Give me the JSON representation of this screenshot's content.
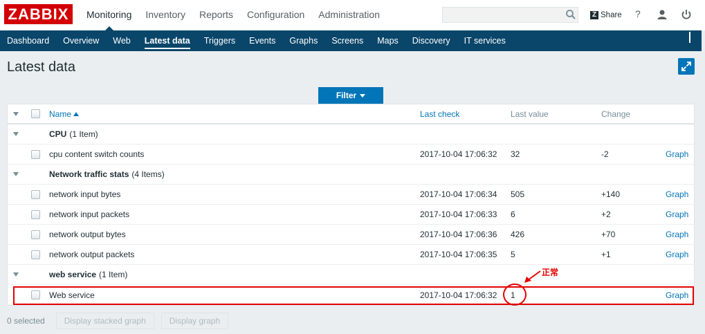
{
  "logo": "ZABBIX",
  "main_menu": [
    "Monitoring",
    "Inventory",
    "Reports",
    "Configuration",
    "Administration"
  ],
  "share_label": "Share",
  "help_label": "?",
  "sub_menu": [
    "Dashboard",
    "Overview",
    "Web",
    "Latest data",
    "Triggers",
    "Events",
    "Graphs",
    "Screens",
    "Maps",
    "Discovery",
    "IT services"
  ],
  "page_title": "Latest data",
  "filter_label": "Filter",
  "table": {
    "headers": {
      "name": "Name",
      "last_check": "Last check",
      "last_value": "Last value",
      "change": "Change"
    },
    "groups": [
      {
        "name": "CPU",
        "count": "(1 Item)"
      },
      {
        "name": "Network traffic stats",
        "count": "(4 Items)"
      },
      {
        "name": "web service",
        "count": "(1 Item)"
      }
    ],
    "rows": [
      {
        "name": "cpu content switch counts",
        "last_check": "2017-10-04 17:06:32",
        "last_value": "32",
        "change": "-2",
        "action": "Graph"
      },
      {
        "name": "network input bytes",
        "last_check": "2017-10-04 17:06:34",
        "last_value": "505",
        "change": "+140",
        "action": "Graph"
      },
      {
        "name": "network input packets",
        "last_check": "2017-10-04 17:06:33",
        "last_value": "6",
        "change": "+2",
        "action": "Graph"
      },
      {
        "name": "network output bytes",
        "last_check": "2017-10-04 17:06:36",
        "last_value": "426",
        "change": "+70",
        "action": "Graph"
      },
      {
        "name": "network output packets",
        "last_check": "2017-10-04 17:06:35",
        "last_value": "5",
        "change": "+1",
        "action": "Graph"
      },
      {
        "name": "Web service",
        "last_check": "2017-10-04 17:06:32",
        "last_value": "1",
        "change": "",
        "action": "Graph"
      }
    ]
  },
  "annotation": "正常",
  "footer": {
    "selected": "0 selected",
    "btn_stacked": "Display stacked graph",
    "btn_graph": "Display graph"
  },
  "colors": {
    "brand": "#d40000",
    "nav": "#0a466a",
    "accent": "#0275b8",
    "annotation": "#e30000"
  }
}
